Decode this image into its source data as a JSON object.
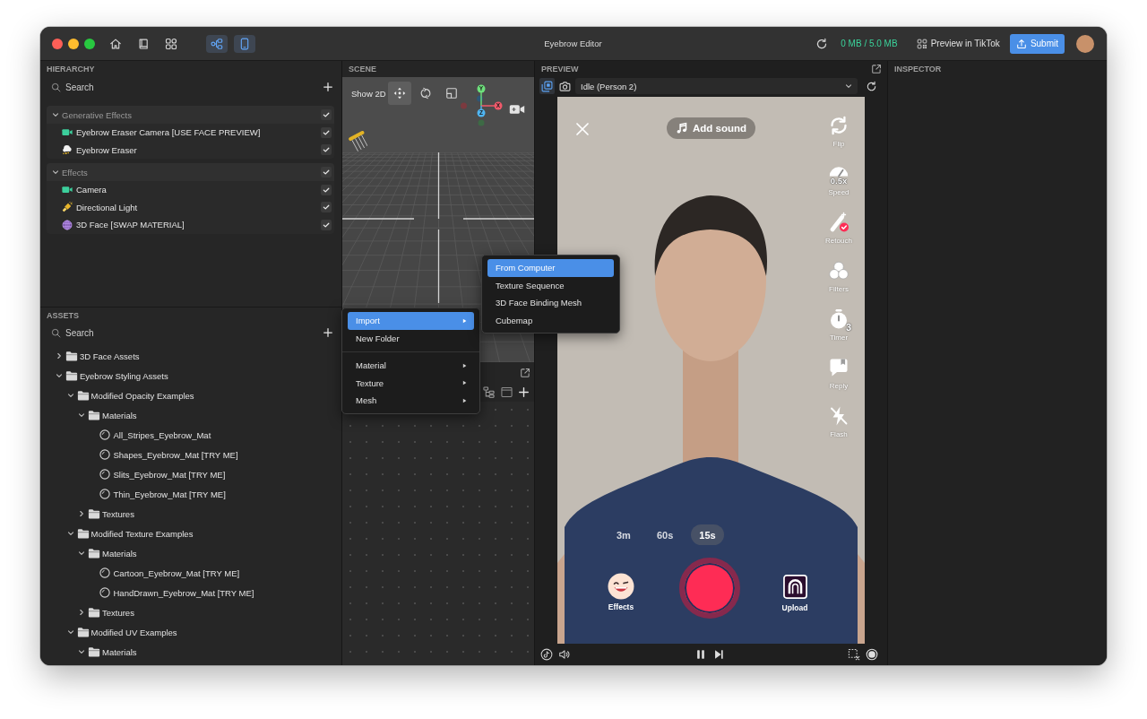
{
  "window": {
    "title": "Eyebrow Editor",
    "panel_toggles": [
      {
        "kind": "graph",
        "on": true
      },
      {
        "kind": "phone",
        "on": true
      }
    ],
    "storage": "0 MB / 5.0 MB",
    "preview_button": "Preview in TikTok",
    "submit_button": "Submit"
  },
  "hierarchy": {
    "title": "HIERARCHY",
    "search": {
      "placeholder": "Search"
    },
    "groups": [
      {
        "label": "Generative Effects",
        "expanded": true,
        "checked": true,
        "items": [
          {
            "label": "Eyebrow Eraser Camera [USE FACE PREVIEW]",
            "kind": "camera",
            "checked": true
          },
          {
            "label": "Eyebrow Eraser",
            "kind": "eraser",
            "checked": true
          }
        ]
      },
      {
        "label": "Effects",
        "expanded": true,
        "checked": true,
        "items": [
          {
            "label": "Camera",
            "kind": "camera",
            "checked": true
          },
          {
            "label": "Directional Light",
            "kind": "light",
            "checked": true
          },
          {
            "label": "3D Face [SWAP MATERIAL]",
            "kind": "face_mesh",
            "checked": true
          }
        ]
      }
    ]
  },
  "assets": {
    "title": "ASSETS",
    "search": {
      "placeholder": "Search"
    },
    "tree": [
      {
        "label": "3D Face Assets",
        "kind": "folder",
        "expanded": false
      },
      {
        "label": "Eyebrow Styling Assets",
        "kind": "folder",
        "expanded": true,
        "children": [
          {
            "label": "Modified Opacity Examples",
            "kind": "folder",
            "expanded": true,
            "children": [
              {
                "label": "Materials",
                "kind": "folder",
                "expanded": true,
                "children": [
                  {
                    "label": "All_Stripes_Eyebrow_Mat",
                    "kind": "material"
                  },
                  {
                    "label": "Shapes_Eyebrow_Mat [TRY ME]",
                    "kind": "material"
                  },
                  {
                    "label": "Slits_Eyebrow_Mat [TRY ME]",
                    "kind": "material"
                  },
                  {
                    "label": "Thin_Eyebrow_Mat [TRY ME]",
                    "kind": "material"
                  }
                ]
              },
              {
                "label": "Textures",
                "kind": "folder",
                "expanded": false
              }
            ]
          },
          {
            "label": "Modified Texture Examples",
            "kind": "folder",
            "expanded": true,
            "children": [
              {
                "label": "Materials",
                "kind": "folder",
                "expanded": true,
                "children": [
                  {
                    "label": "Cartoon_Eyebrow_Mat [TRY ME]",
                    "kind": "material"
                  },
                  {
                    "label": "HandDrawn_Eyebrow_Mat [TRY ME]",
                    "kind": "material"
                  }
                ]
              },
              {
                "label": "Textures",
                "kind": "folder",
                "expanded": false
              }
            ]
          },
          {
            "label": "Modified UV Examples",
            "kind": "folder",
            "expanded": true,
            "children": [
              {
                "label": "Materials",
                "kind": "folder",
                "expanded": true
              }
            ]
          }
        ]
      }
    ]
  },
  "scene": {
    "title": "SCENE",
    "show_2d": "Show 2D",
    "tools": [
      {
        "kind": "move",
        "selected": true
      },
      {
        "kind": "rotate",
        "selected": false
      },
      {
        "kind": "scale",
        "selected": false
      }
    ],
    "axis_labels": [
      "Y",
      "X",
      "Z"
    ]
  },
  "context_menu": {
    "sections": [
      {
        "items": [
          {
            "label": "Import",
            "selected": true,
            "has_submenu": true
          },
          {
            "label": "New Folder",
            "selected": false,
            "has_submenu": false
          }
        ]
      },
      {
        "items": [
          {
            "label": "Material",
            "selected": false,
            "has_submenu": true
          },
          {
            "label": "Texture",
            "selected": false,
            "has_submenu": true
          },
          {
            "label": "Mesh",
            "selected": false,
            "has_submenu": true
          }
        ]
      }
    ],
    "submenu": {
      "items": [
        {
          "label": "From Computer",
          "selected": true
        },
        {
          "label": "Texture Sequence",
          "selected": false
        },
        {
          "label": "3D Face Binding Mesh",
          "selected": false
        },
        {
          "label": "Cubemap",
          "selected": false
        }
      ]
    }
  },
  "preview": {
    "title": "PREVIEW",
    "view_modes": [
      {
        "kind": "layers",
        "selected": true
      },
      {
        "kind": "camera",
        "selected": false
      }
    ],
    "scene_select": {
      "value": "Idle (Person 2)"
    },
    "phone": {
      "add_sound": "Add sound",
      "side_actions": [
        {
          "kind": "flip",
          "label": "Flip"
        },
        {
          "kind": "speed",
          "label": "Speed",
          "value": "0.5x"
        },
        {
          "kind": "retouch",
          "label": "Retouch"
        },
        {
          "kind": "filters",
          "label": "Filters"
        },
        {
          "kind": "timer",
          "label": "Timer",
          "value": "3"
        },
        {
          "kind": "reply",
          "label": "Reply"
        },
        {
          "kind": "flash",
          "label": "Flash"
        }
      ],
      "durations": [
        {
          "label": "3m",
          "selected": false
        },
        {
          "label": "60s",
          "selected": false
        },
        {
          "label": "15s",
          "selected": true
        }
      ],
      "effects_button": "Effects",
      "upload_button": "Upload"
    }
  },
  "inspector": {
    "title": "INSPECTOR"
  }
}
